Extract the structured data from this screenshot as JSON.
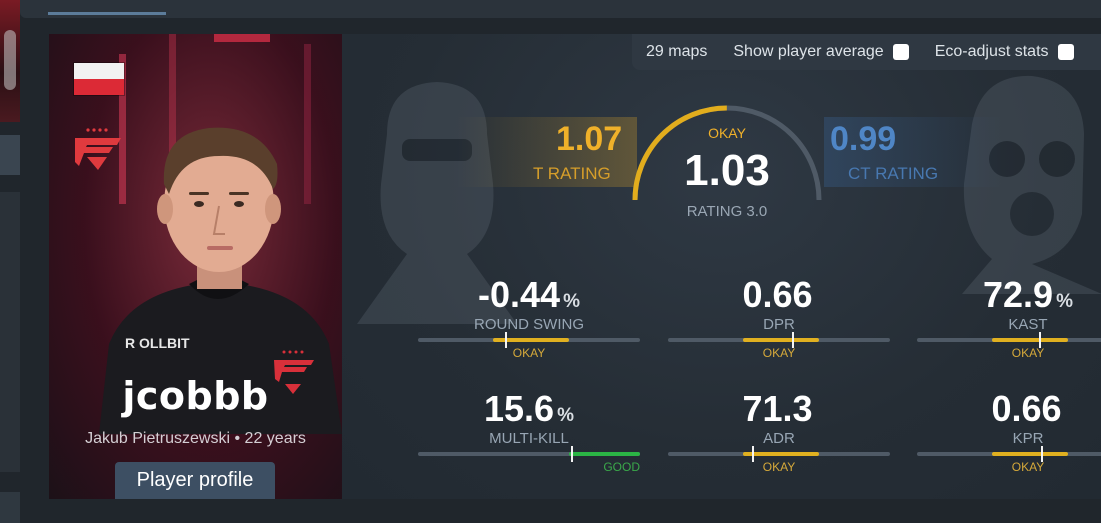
{
  "player": {
    "nickname": "jcobbb",
    "real_name": "Jakub Pietruszewski",
    "separator": "•",
    "age": "22 years",
    "profile_button": "Player profile",
    "flag_icon": "poland-flag-icon",
    "team_logo": "faze-logo-icon"
  },
  "options": {
    "maps": "29 maps",
    "show_average": "Show player average",
    "eco_adjust": "Eco-adjust stats"
  },
  "rating": {
    "t_value": "1.07",
    "t_label": "T RATING",
    "ct_value": "0.99",
    "ct_label": "CT RATING",
    "state": "OKAY",
    "value": "1.03",
    "label": "RATING 3.0",
    "gauge_fraction": 0.5
  },
  "stats": [
    {
      "value": "-0.44",
      "unit": "%",
      "label": "ROUND SWING",
      "state": "OKAY",
      "level": 0.39,
      "color": "#e0b020"
    },
    {
      "value": "0.66",
      "unit": "",
      "label": "DPR",
      "state": "OKAY",
      "level": 0.56,
      "color": "#e0b020"
    },
    {
      "value": "72.9",
      "unit": "%",
      "label": "KAST",
      "state": "OKAY",
      "level": 0.55,
      "color": "#e0b020"
    },
    {
      "value": "15.6",
      "unit": "%",
      "label": "MULTI-KILL",
      "state": "GOOD",
      "level": 0.69,
      "color": "#2bb545"
    },
    {
      "value": "71.3",
      "unit": "",
      "label": "ADR",
      "state": "OKAY",
      "level": 0.38,
      "color": "#e0b020"
    },
    {
      "value": "0.66",
      "unit": "",
      "label": "KPR",
      "state": "OKAY",
      "level": 0.56,
      "color": "#e0b020"
    }
  ],
  "colors": {
    "t_side": "#f0b12a",
    "ct_side": "#4f86c6",
    "okay": "#d5a93a",
    "good": "#3aa84a"
  }
}
